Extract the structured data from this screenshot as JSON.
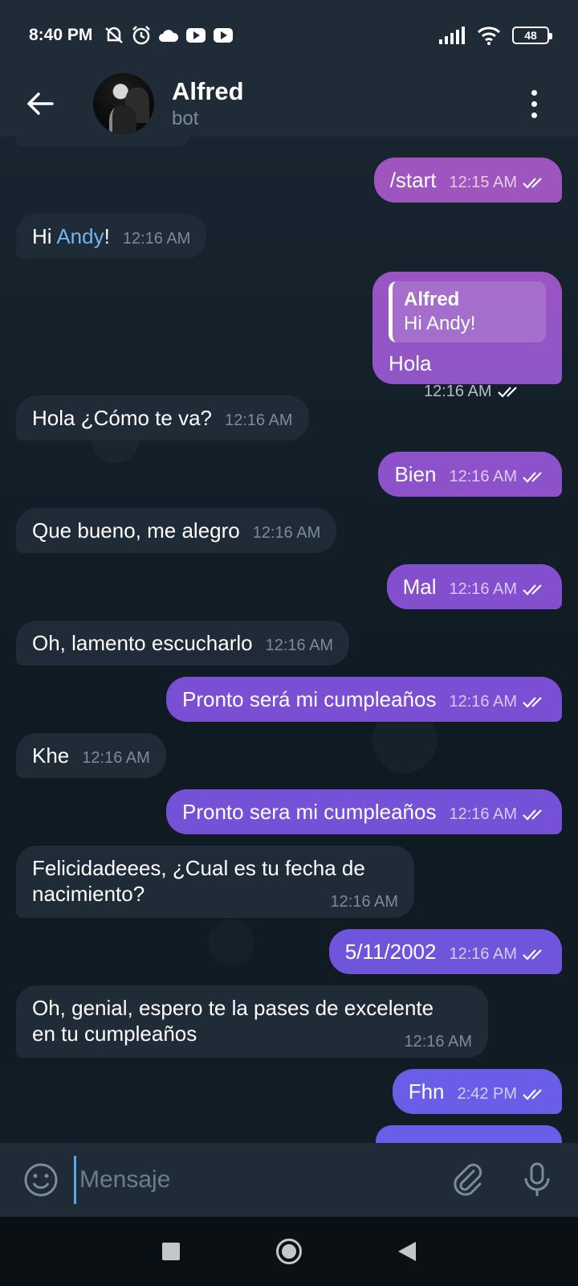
{
  "status_bar": {
    "time": "8:40 PM",
    "battery": "48",
    "icons": [
      "mute-icon",
      "alarm-icon",
      "cloud-icon",
      "youtube-icon",
      "youtube-icon",
      "signal-icon",
      "wifi-icon",
      "battery-icon"
    ]
  },
  "header": {
    "title": "Alfred",
    "subtitle": "bot"
  },
  "colors": {
    "incoming_bubble": "#1f2b37",
    "outgoing_gradient_top": "#a055c0",
    "outgoing_gradient_bottom": "#6a5ee8",
    "mention": "#6fb6f5",
    "header": "#1f2c38"
  },
  "messages": [
    {
      "dir": "out",
      "text": "/start",
      "time": "12:15 AM"
    },
    {
      "dir": "in",
      "text_before": "Hi ",
      "mention": "Andy",
      "text_after": "!",
      "time": "12:16 AM"
    },
    {
      "dir": "out",
      "reply_name": "Alfred",
      "reply_text": "Hi Andy!",
      "text": "Hola",
      "time": "12:16 AM"
    },
    {
      "dir": "in",
      "text": "Hola ¿Cómo te va?",
      "time": "12:16 AM"
    },
    {
      "dir": "out",
      "text": "Bien",
      "time": "12:16 AM"
    },
    {
      "dir": "in",
      "text": "Que bueno, me alegro",
      "time": "12:16 AM"
    },
    {
      "dir": "out",
      "text": "Mal",
      "time": "12:16 AM"
    },
    {
      "dir": "in",
      "text": "Oh, lamento escucharlo",
      "time": "12:16 AM"
    },
    {
      "dir": "out",
      "text": "Pronto será mi cumpleaños",
      "time": "12:16 AM"
    },
    {
      "dir": "in",
      "text": "Khe",
      "time": "12:16 AM"
    },
    {
      "dir": "out",
      "text": "Pronto sera mi cumpleaños",
      "time": "12:16 AM"
    },
    {
      "dir": "in",
      "line1": "Felicidadeees, ¿Cual es tu fecha de",
      "line2": "nacimiento?",
      "time": "12:16 AM"
    },
    {
      "dir": "out",
      "text": "5/11/2002",
      "time": "12:16 AM"
    },
    {
      "dir": "in",
      "line1": "Oh, genial, espero te la pases de excelente",
      "line2": "en tu cumpleaños",
      "time": "12:16 AM"
    },
    {
      "dir": "out",
      "text": "Fhn",
      "time": "2:42 PM"
    }
  ],
  "input": {
    "placeholder": "Mensaje",
    "value": ""
  }
}
